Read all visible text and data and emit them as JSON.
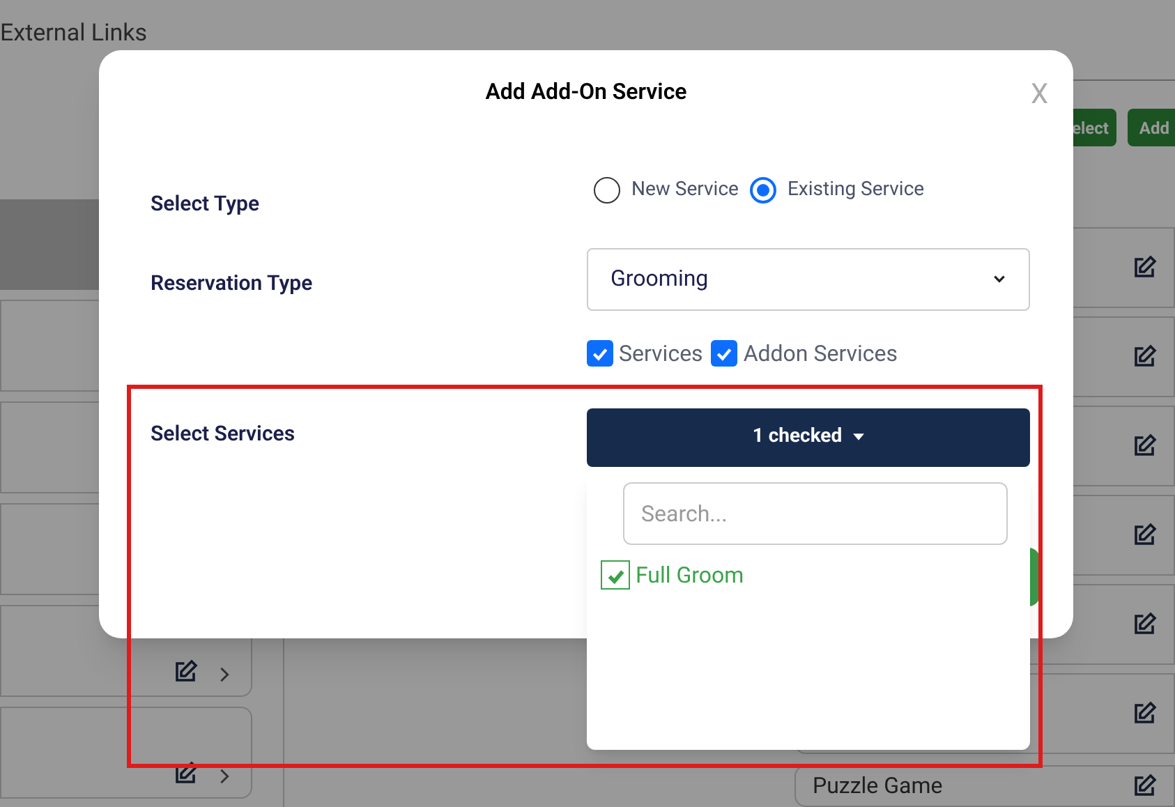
{
  "background": {
    "heading": "External Links",
    "buttons": [
      "elect",
      "Add"
    ],
    "list_item": "Puzzle Game"
  },
  "dialog": {
    "title": "Add Add-On Service",
    "close": "X",
    "select_type": {
      "label": "Select Type",
      "options": [
        {
          "label": "New Service",
          "selected": false
        },
        {
          "label": "Existing Service",
          "selected": true
        }
      ]
    },
    "reservation_type": {
      "label": "Reservation Type",
      "value": "Grooming"
    },
    "filters": [
      {
        "label": "Services",
        "checked": true
      },
      {
        "label": "Addon Services",
        "checked": true
      }
    ],
    "select_services": {
      "label": "Select Services",
      "button": "1 checked",
      "search": {
        "placeholder": "Search..."
      },
      "options": [
        {
          "label": "Full Groom",
          "checked": true
        }
      ]
    }
  }
}
